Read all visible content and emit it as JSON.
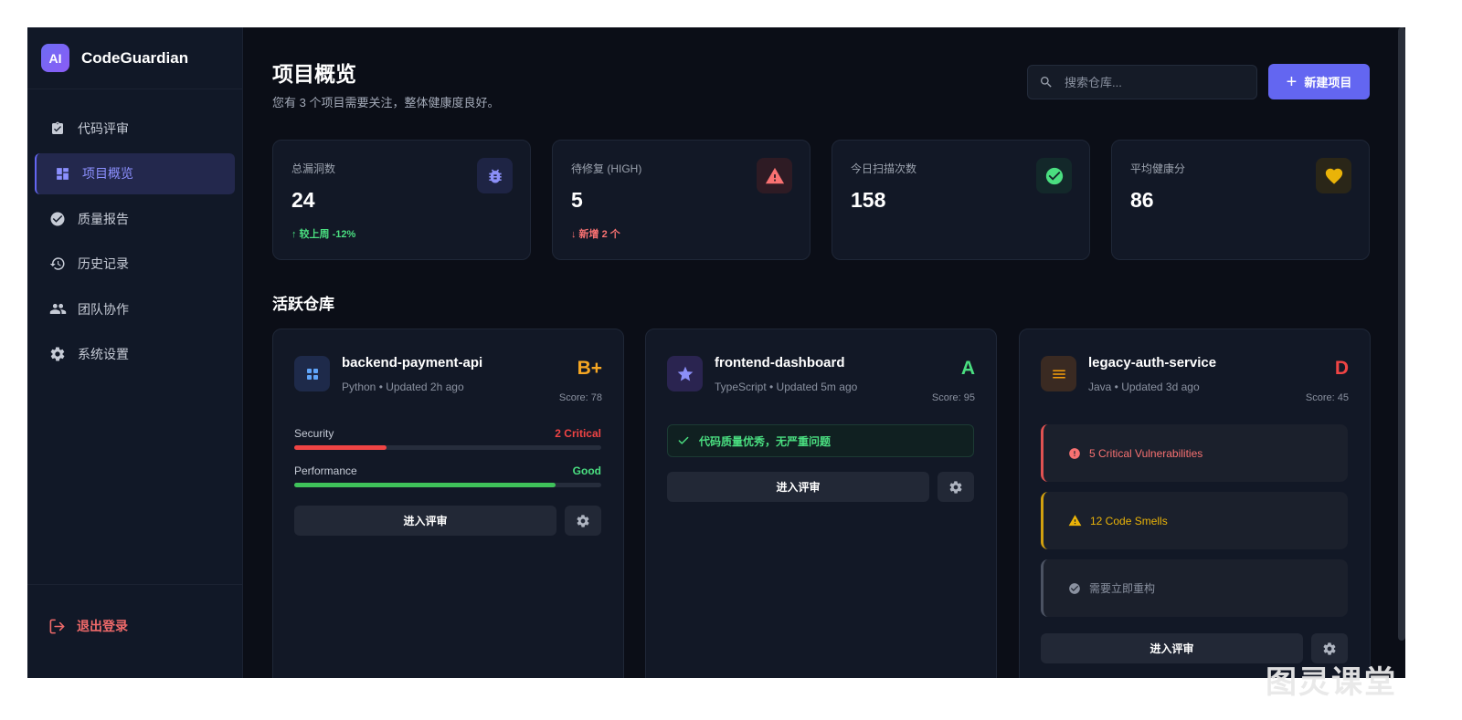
{
  "brand": {
    "logo": "AI",
    "name": "CodeGuardian"
  },
  "sidebar": {
    "items": [
      {
        "label": "代码评审",
        "icon": "clipboard-check-icon",
        "active": false
      },
      {
        "label": "项目概览",
        "icon": "dashboard-icon",
        "active": true
      },
      {
        "label": "质量报告",
        "icon": "check-circle-icon",
        "active": false
      },
      {
        "label": "历史记录",
        "icon": "history-icon",
        "active": false
      },
      {
        "label": "团队协作",
        "icon": "people-icon",
        "active": false
      },
      {
        "label": "系统设置",
        "icon": "gear-icon",
        "active": false
      }
    ],
    "logout": "退出登录"
  },
  "header": {
    "title": "项目概览",
    "subtitle": "您有 3 个项目需要关注，整体健康度良好。",
    "search_placeholder": "搜索仓库...",
    "new_button": "新建项目"
  },
  "stats": [
    {
      "label": "总漏洞数",
      "value": "24",
      "trend": "↑ 较上周 -12%",
      "trend_color": "#4ade80",
      "icon": "bug-icon",
      "icon_color": "#8b8ff8"
    },
    {
      "label": "待修复 (HIGH)",
      "value": "5",
      "trend": "↓ 新增 2 个",
      "trend_color": "#f87171",
      "icon": "warning-icon",
      "icon_color": "#f87171"
    },
    {
      "label": "今日扫描次数",
      "value": "158",
      "trend": "",
      "icon": "check-circle-icon",
      "icon_color": "#4ade80"
    },
    {
      "label": "平均健康分",
      "value": "86",
      "trend": "",
      "icon": "heart-icon",
      "icon_color": "#eab308"
    }
  ],
  "section_title": "活跃仓库",
  "repos": [
    {
      "name": "backend-payment-api",
      "meta": "Python • Updated 2h ago",
      "grade": "B+",
      "grade_color": "#f5a623",
      "score": "Score: 78",
      "icon": "grid-icon",
      "metrics": [
        {
          "label": "Security",
          "value": "2 Critical",
          "color": "#ef4444",
          "fill": 0.3
        },
        {
          "label": "Performance",
          "value": "Good",
          "color": "#4ade80",
          "fill": 0.85
        }
      ],
      "button": "进入评审"
    },
    {
      "name": "frontend-dashboard",
      "meta": "TypeScript • Updated 5m ago",
      "grade": "A",
      "grade_color": "#4ade80",
      "score": "Score: 95",
      "icon": "star-icon",
      "banner": "代码质量优秀，无严重问题",
      "button": "进入评审"
    },
    {
      "name": "legacy-auth-service",
      "meta": "Java • Updated 3d ago",
      "grade": "D",
      "grade_color": "#ef4444",
      "score": "Score: 45",
      "icon": "menu-icon",
      "issues": [
        {
          "text": "5 Critical Vulnerabilities",
          "color": "#f87171",
          "icon": "error-icon"
        },
        {
          "text": "12 Code Smells",
          "color": "#eab308",
          "icon": "warning-icon"
        },
        {
          "text": "需要立即重构",
          "color": "#8a91a0",
          "icon": "check-circle-icon"
        }
      ],
      "button": "进入评审"
    }
  ],
  "watermark": "图灵课堂"
}
